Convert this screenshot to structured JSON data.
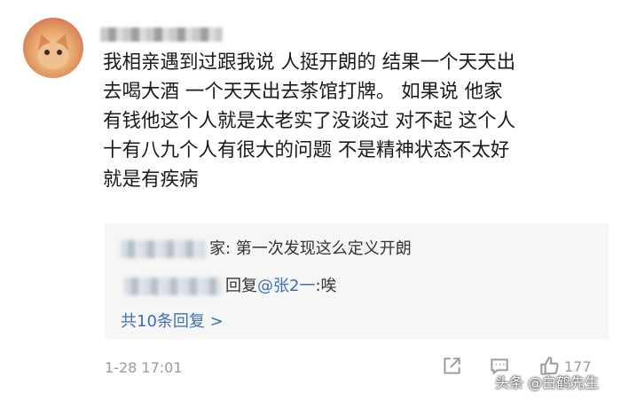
{
  "post": {
    "content_lines": [
      "我相亲遇到过跟我说 人挺开朗的 结果一个天天出",
      "去喝大酒  一个天天出去茶馆打牌。 如果说  他家",
      "有钱他这个人就是太老实了没谈过 对不起 这个人",
      "十有八九个人有很大的问题 不是精神状态不太好",
      "就是有疾病"
    ],
    "timestamp": "1-28 17:01",
    "like_count": "177"
  },
  "replies": [
    {
      "separator": "家: ",
      "text": "第一次发现这么定义开朗"
    },
    {
      "prefix": "回复",
      "mention": "@张2一",
      "text": ":唉"
    }
  ],
  "more_replies_label": "共10条回复 >",
  "icons": {
    "share": "share-icon",
    "comment": "comment-icon",
    "like": "thumbs-up-icon"
  },
  "watermark": "头条 @白鹤先生",
  "colors": {
    "link": "#3e6fb1",
    "meta": "#9a9a9a",
    "reply_bg": "#f6f6f6"
  }
}
